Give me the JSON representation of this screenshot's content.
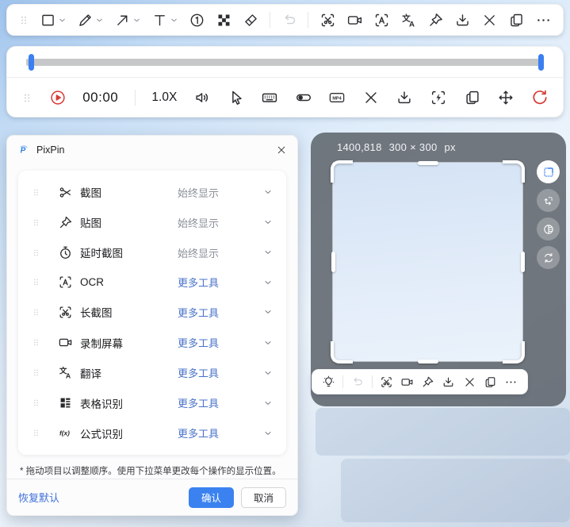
{
  "colors": {
    "accent": "#3b82f0",
    "link_blue": "#4a73c9",
    "muted_gray": "#8a9099",
    "danger_red": "#d93a35",
    "overlay_gray": "#565b63"
  },
  "annotate_toolbar": {
    "items": [
      {
        "type": "handle",
        "name": "annotation-toolbar-drag-handle",
        "icon": "grip"
      },
      {
        "type": "icon",
        "name": "rectangle-tool-button",
        "icon": "rect",
        "chevron": true
      },
      {
        "type": "icon",
        "name": "pencil-tool-button",
        "icon": "pencil",
        "chevron": true
      },
      {
        "type": "icon",
        "name": "arrow-tool-button",
        "icon": "arrow",
        "chevron": true
      },
      {
        "type": "icon",
        "name": "text-tool-button",
        "icon": "text",
        "chevron": true
      },
      {
        "type": "icon",
        "name": "number-marker-button",
        "icon": "number1"
      },
      {
        "type": "icon",
        "name": "mosaic-tool-button",
        "icon": "mosaic"
      },
      {
        "type": "icon",
        "name": "eraser-tool-button",
        "icon": "eraser"
      },
      {
        "type": "divider"
      },
      {
        "type": "icon",
        "name": "undo-button",
        "icon": "undo",
        "disabled": true
      },
      {
        "type": "divider"
      },
      {
        "type": "icon",
        "name": "long-screenshot-button",
        "icon": "scissors-frame"
      },
      {
        "type": "icon",
        "name": "record-screen-button",
        "icon": "camera"
      },
      {
        "type": "icon",
        "name": "ocr-button",
        "icon": "ocr"
      },
      {
        "type": "icon",
        "name": "translate-button",
        "icon": "translate"
      },
      {
        "type": "icon",
        "name": "pin-button",
        "icon": "pin"
      },
      {
        "type": "icon",
        "name": "save-button",
        "icon": "download"
      },
      {
        "type": "icon",
        "name": "close-button",
        "icon": "close"
      },
      {
        "type": "icon",
        "name": "copy-button",
        "icon": "copy"
      },
      {
        "type": "icon",
        "name": "more-button",
        "icon": "more"
      }
    ]
  },
  "recorder": {
    "time": "00:00",
    "speed": "1.0X",
    "items": [
      {
        "type": "handle",
        "name": "recorder-drag-handle",
        "icon": "grip"
      },
      {
        "type": "icon",
        "name": "play-button",
        "icon": "play",
        "color": "danger"
      },
      {
        "type": "text",
        "name": "time-display",
        "bindkey": "time",
        "cls": "time"
      },
      {
        "type": "divider"
      },
      {
        "type": "text",
        "name": "speed-button",
        "bindkey": "speed",
        "cls": "speed",
        "interactable": true
      },
      {
        "type": "icon",
        "name": "volume-button",
        "icon": "volume"
      },
      {
        "type": "icon",
        "name": "cursor-toggle-button",
        "icon": "cursor"
      },
      {
        "type": "icon",
        "name": "keyboard-overlay-button",
        "icon": "keyboard"
      },
      {
        "type": "icon",
        "name": "record-toggle-button",
        "icon": "toggle"
      },
      {
        "type": "icon",
        "name": "format-mp4-button",
        "icon": "mp4"
      },
      {
        "type": "icon",
        "name": "cancel-recording-button",
        "icon": "close"
      },
      {
        "type": "icon",
        "name": "save-recording-button",
        "icon": "download"
      },
      {
        "type": "icon",
        "name": "frame-capture-button",
        "icon": "flash-frame"
      },
      {
        "type": "icon",
        "name": "copy-recording-button",
        "icon": "copy"
      },
      {
        "type": "icon",
        "name": "move-toolbar-button",
        "icon": "move"
      },
      {
        "type": "icon",
        "name": "restart-recording-button",
        "icon": "restart",
        "color": "danger"
      }
    ]
  },
  "dialog": {
    "title": "PixPin",
    "items": [
      {
        "icon": "scissors",
        "label": "截图",
        "value": "始终显示",
        "value_style": "muted"
      },
      {
        "icon": "pin",
        "label": "贴图",
        "value": "始终显示",
        "value_style": "muted"
      },
      {
        "icon": "timer",
        "label": "延时截图",
        "value": "始终显示",
        "value_style": "muted"
      },
      {
        "icon": "ocr",
        "label": "OCR",
        "value": "更多工具",
        "value_style": "link"
      },
      {
        "icon": "scissors-frame",
        "label": "长截图",
        "value": "更多工具",
        "value_style": "link"
      },
      {
        "icon": "camera",
        "label": "录制屏幕",
        "value": "更多工具",
        "value_style": "link"
      },
      {
        "icon": "translate",
        "label": "翻译",
        "value": "更多工具",
        "value_style": "link"
      },
      {
        "icon": "table",
        "label": "表格识别",
        "value": "更多工具",
        "value_style": "link"
      },
      {
        "icon": "fx",
        "label": "公式识别",
        "value": "更多工具",
        "value_style": "link"
      }
    ],
    "note": "* 拖动项目以调整顺序。使用下拉菜单更改每个操作的显示位置。",
    "restore_label": "恢复默认",
    "confirm_label": "确认",
    "cancel_label": "取消"
  },
  "capture": {
    "position": "1400,818",
    "size": "300 × 300",
    "unit": "px",
    "side_tools": [
      {
        "name": "selection-mode-button",
        "icon": "select-region",
        "active": true
      },
      {
        "name": "resize-selection-button",
        "icon": "resize"
      },
      {
        "name": "contrast-button",
        "icon": "contrast"
      },
      {
        "name": "refresh-selection-button",
        "icon": "refresh"
      }
    ],
    "toolbar_items": [
      {
        "type": "icon",
        "name": "hint-bulb-button",
        "icon": "bulb"
      },
      {
        "type": "divider"
      },
      {
        "type": "icon",
        "name": "undo-button",
        "icon": "undo",
        "disabled": true
      },
      {
        "type": "divider"
      },
      {
        "type": "icon",
        "name": "long-screenshot-button",
        "icon": "scissors-frame"
      },
      {
        "type": "icon",
        "name": "record-screen-button",
        "icon": "camera"
      },
      {
        "type": "icon",
        "name": "pin-button",
        "icon": "pin"
      },
      {
        "type": "icon",
        "name": "save-button",
        "icon": "download"
      },
      {
        "type": "icon",
        "name": "close-button",
        "icon": "close"
      },
      {
        "type": "icon",
        "name": "copy-button",
        "icon": "copy"
      },
      {
        "type": "icon",
        "name": "more-button",
        "icon": "more"
      }
    ]
  }
}
